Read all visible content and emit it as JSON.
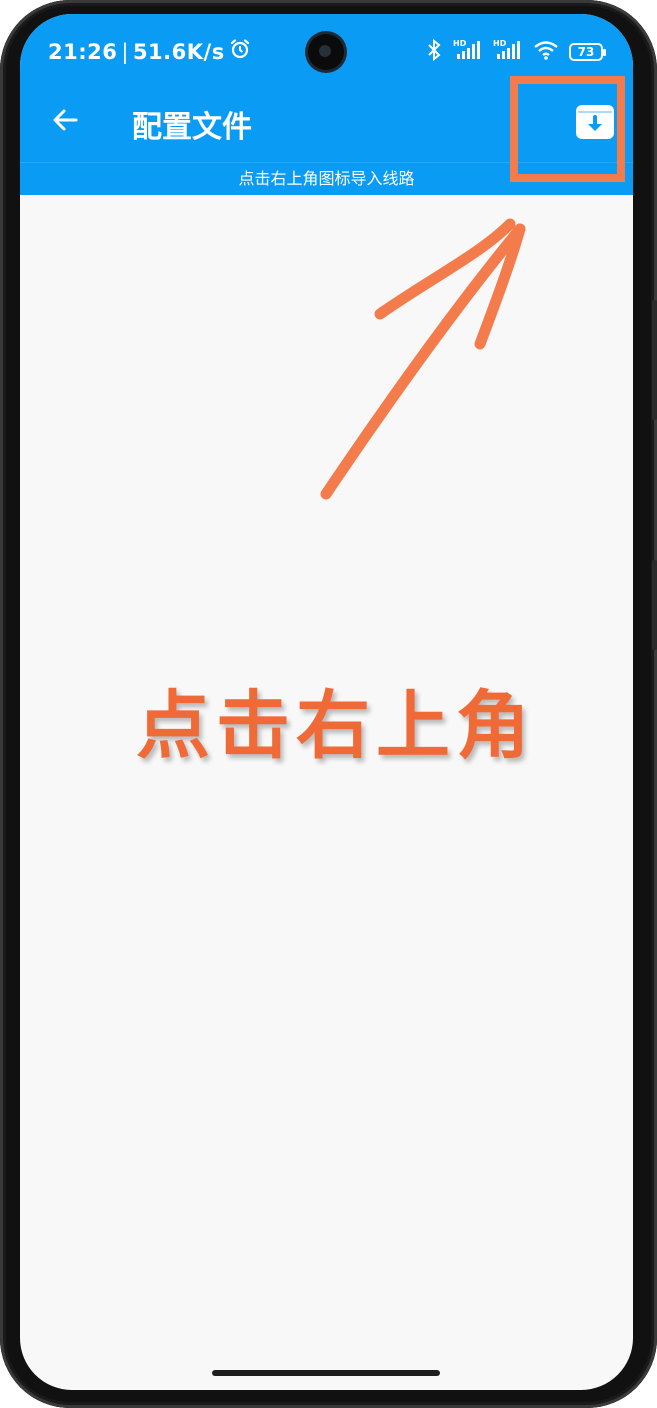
{
  "status_bar": {
    "time": "21:26",
    "separator": "|",
    "net_speed": "51.6K/s",
    "battery_level": "73",
    "icons": [
      "alarm-icon",
      "bluetooth-icon",
      "signal-hd-icon",
      "signal-hd-icon",
      "wifi-icon",
      "battery-icon"
    ]
  },
  "app_bar": {
    "back_icon": "arrow-left-icon",
    "title": "配置文件",
    "action_icon": "import-archive-icon",
    "subtitle": "点击右上角图标导入线路"
  },
  "annotation": {
    "text": "点击右上角",
    "color": "#f06a38"
  },
  "colors": {
    "accent": "#0a9cf5",
    "background": "#f8f8f8",
    "highlight": "#f47c4c"
  }
}
